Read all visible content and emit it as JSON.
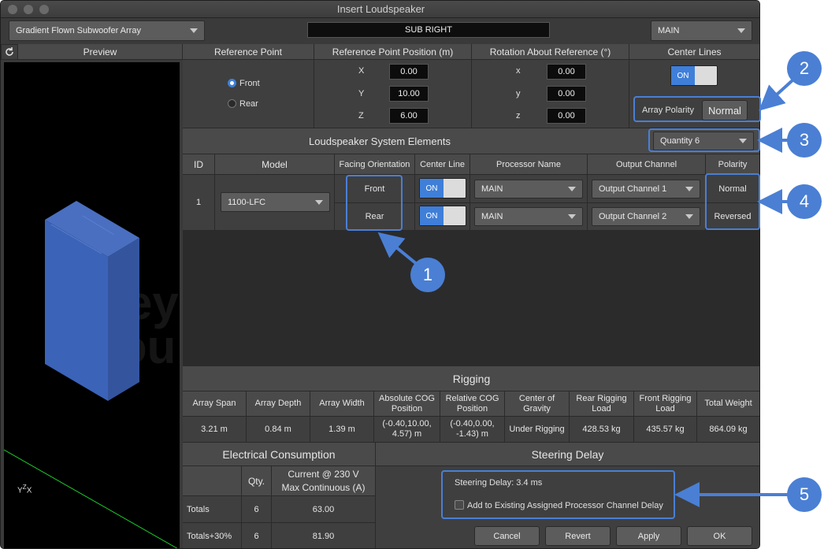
{
  "window": {
    "title": "Insert Loudspeaker"
  },
  "top": {
    "array_type": "Gradient Flown Subwoofer Array",
    "name": "SUB RIGHT",
    "group": "MAIN"
  },
  "preview": {
    "title": "Preview",
    "watermark_line1": "Mey",
    "watermark_line2": "Sou",
    "axis_y": "Y",
    "axis_z": "Z",
    "axis_x": "X"
  },
  "reference_point": {
    "header": "Reference Point",
    "front_label": "Front",
    "rear_label": "Rear",
    "selected": "Front"
  },
  "ref_position": {
    "header": "Reference Point Position (m)",
    "x_label": "X",
    "x": "0.00",
    "y_label": "Y",
    "y": "10.00",
    "z_label": "Z",
    "z": "6.00"
  },
  "rotation": {
    "header": "Rotation About Reference (°)",
    "x_label": "x",
    "x": "0.00",
    "y_label": "y",
    "y": "0.00",
    "z_label": "z",
    "z": "0.00"
  },
  "center_lines": {
    "header": "Center Lines",
    "toggle": "ON"
  },
  "array_polarity": {
    "label": "Array Polarity",
    "value": "Normal"
  },
  "elements": {
    "header": "Loudspeaker System Elements",
    "quantity": "Quantity 6",
    "columns": [
      "ID",
      "Model",
      "Facing Orientation",
      "Center Line",
      "Processor Name",
      "Output Channel",
      "Polarity"
    ],
    "id": "1",
    "model": "1100-LFC",
    "rows": [
      {
        "facing": "Front",
        "center_line": "ON",
        "processor": "MAIN",
        "output": "Output Channel 1",
        "polarity": "Normal"
      },
      {
        "facing": "Rear",
        "center_line": "ON",
        "processor": "MAIN",
        "output": "Output Channel 2",
        "polarity": "Reversed"
      }
    ]
  },
  "rigging": {
    "header": "Rigging",
    "columns": [
      "Array Span",
      "Array Depth",
      "Array Width",
      "Absolute COG Position",
      "Relative COG Position",
      "Center of Gravity",
      "Rear Rigging Load",
      "Front Rigging Load",
      "Total Weight"
    ],
    "values": [
      "3.21 m",
      "0.84 m",
      "1.39 m",
      "(-0.40,10.00, 4.57) m",
      "(-0.40,0.00, -1.43) m",
      "Under Rigging",
      "428.53 kg",
      "435.57 kg",
      "864.09 kg"
    ]
  },
  "electrical": {
    "header": "Electrical Consumption",
    "qty_header": "Qty.",
    "current_header_1": "Current @ 230 V",
    "current_header_2": "Max Continuous (A)",
    "rows": [
      {
        "label": "Totals",
        "qty": "6",
        "current": "63.00"
      },
      {
        "label": "Totals+30%",
        "qty": "6",
        "current": "81.90"
      }
    ]
  },
  "steering": {
    "header": "Steering Delay",
    "delay_text": "Steering Delay: 3.4 ms",
    "checkbox_label": "Add to Existing Assigned Processor Channel Delay"
  },
  "buttons": {
    "cancel": "Cancel",
    "revert": "Revert",
    "apply": "Apply",
    "ok": "OK"
  },
  "callouts": [
    "1",
    "2",
    "3",
    "4",
    "5"
  ],
  "colors": {
    "accent": "#4a7fd4",
    "toggle_on": "#3f7fd9",
    "speaker": "#3b63b8"
  }
}
